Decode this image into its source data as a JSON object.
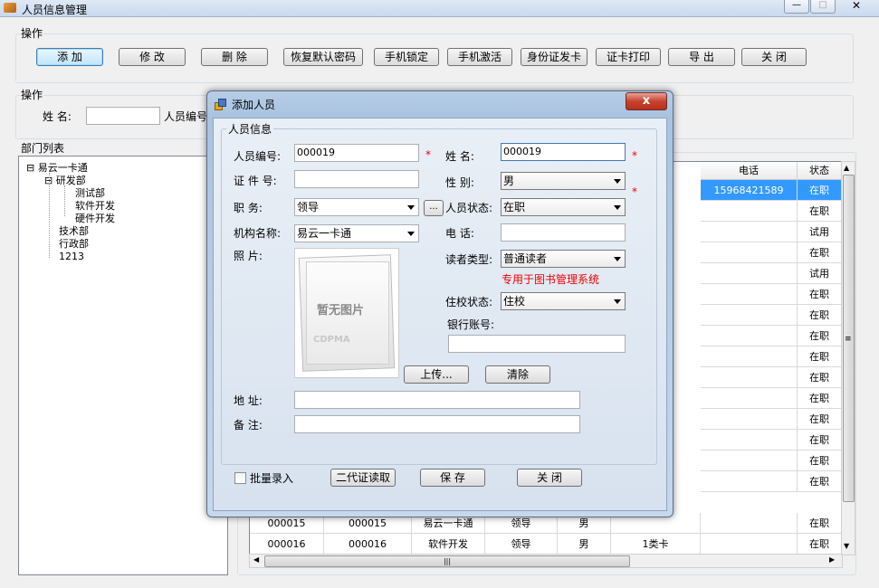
{
  "window": {
    "title": "人员信息管理",
    "minimize": "—",
    "maximize": "□",
    "close": "✕"
  },
  "ops_group": {
    "label": "操作",
    "buttons": [
      "添 加",
      "修 改",
      "删 除",
      "恢复默认密码",
      "手机锁定",
      "手机激活",
      "身份证发卡",
      "证卡打印",
      "导 出",
      "关 闭"
    ]
  },
  "search_group": {
    "label": "操作",
    "name_label": "姓  名:",
    "name_value": "",
    "id_label": "人员编号"
  },
  "dept": {
    "label": "部门列表",
    "tree": [
      {
        "text": "易云一卡通",
        "toggle": "⊟"
      },
      {
        "text": "研发部",
        "toggle": "⊟"
      },
      {
        "text": "测试部"
      },
      {
        "text": "软件开发"
      },
      {
        "text": "硬件开发"
      },
      {
        "text": "技术部"
      },
      {
        "text": "行政部"
      },
      {
        "text": "1213"
      }
    ]
  },
  "grid": {
    "header": {
      "phone": "电话",
      "status": "状态"
    },
    "right_rows": [
      {
        "phone": "15968421589",
        "status": "在职"
      },
      {
        "phone": "",
        "status": "在职"
      },
      {
        "phone": "",
        "status": "试用"
      },
      {
        "phone": "",
        "status": "在职"
      },
      {
        "phone": "",
        "status": "试用"
      },
      {
        "phone": "",
        "status": "在职"
      },
      {
        "phone": "",
        "status": "在职"
      },
      {
        "phone": "",
        "status": "在职"
      },
      {
        "phone": "",
        "status": "在职"
      },
      {
        "phone": "",
        "status": "在职"
      },
      {
        "phone": "",
        "status": "在职"
      },
      {
        "phone": "",
        "status": "在职"
      },
      {
        "phone": "",
        "status": "在职"
      },
      {
        "phone": "",
        "status": "在职"
      },
      {
        "phone": "",
        "status": "在职"
      }
    ],
    "rows": [
      {
        "no": "000015",
        "card": "000015",
        "dept": "易云一卡通",
        "job": "领导",
        "sex": "男",
        "card_type": "",
        "phone": "",
        "status": "在职"
      },
      {
        "no": "000016",
        "card": "000016",
        "dept": "软件开发",
        "job": "领导",
        "sex": "男",
        "card_type": "1类卡",
        "phone": "",
        "status": "在职"
      }
    ],
    "scroll_up": "▲",
    "scroll_down": "▼",
    "scroll_left": "◀",
    "scroll_right": "▶",
    "scroll_grip": "≡",
    "hscroll_grip": "|||"
  },
  "dialog": {
    "title": "添加人员",
    "close": "x",
    "section": "人员信息",
    "fields": {
      "person_no": {
        "label": "人员编号:",
        "value": "000019"
      },
      "name": {
        "label": "姓    名:",
        "value": "000019"
      },
      "id_no": {
        "label": "证 件 号:",
        "value": ""
      },
      "sex": {
        "label": "性    别:",
        "value": "男"
      },
      "job": {
        "label": "职    务:",
        "value": "领导",
        "browse": "..."
      },
      "status": {
        "label": "人员状态:",
        "value": "在职"
      },
      "org": {
        "label": "机构名称:",
        "value": "易云一卡通"
      },
      "phone": {
        "label": "电  话:",
        "value": ""
      },
      "photo": {
        "label": "照    片:",
        "placeholder": "暂无图片",
        "watermark": "CDPMA"
      },
      "reader_type": {
        "label": "读者类型:",
        "value": "普通读者",
        "hint": "专用于图书管理系统"
      },
      "dorm": {
        "label": "住校状态:",
        "value": "住校"
      },
      "bank": {
        "label": "银行账号:",
        "value": ""
      },
      "address": {
        "label": "地    址:",
        "value": ""
      },
      "remark": {
        "label": "备    注:",
        "value": ""
      }
    },
    "star": "*",
    "upload": "上传...",
    "clear": "清除",
    "batch": "批量录入",
    "read_id": "二代证读取",
    "save": "保  存",
    "close_btn": "关  闭"
  }
}
